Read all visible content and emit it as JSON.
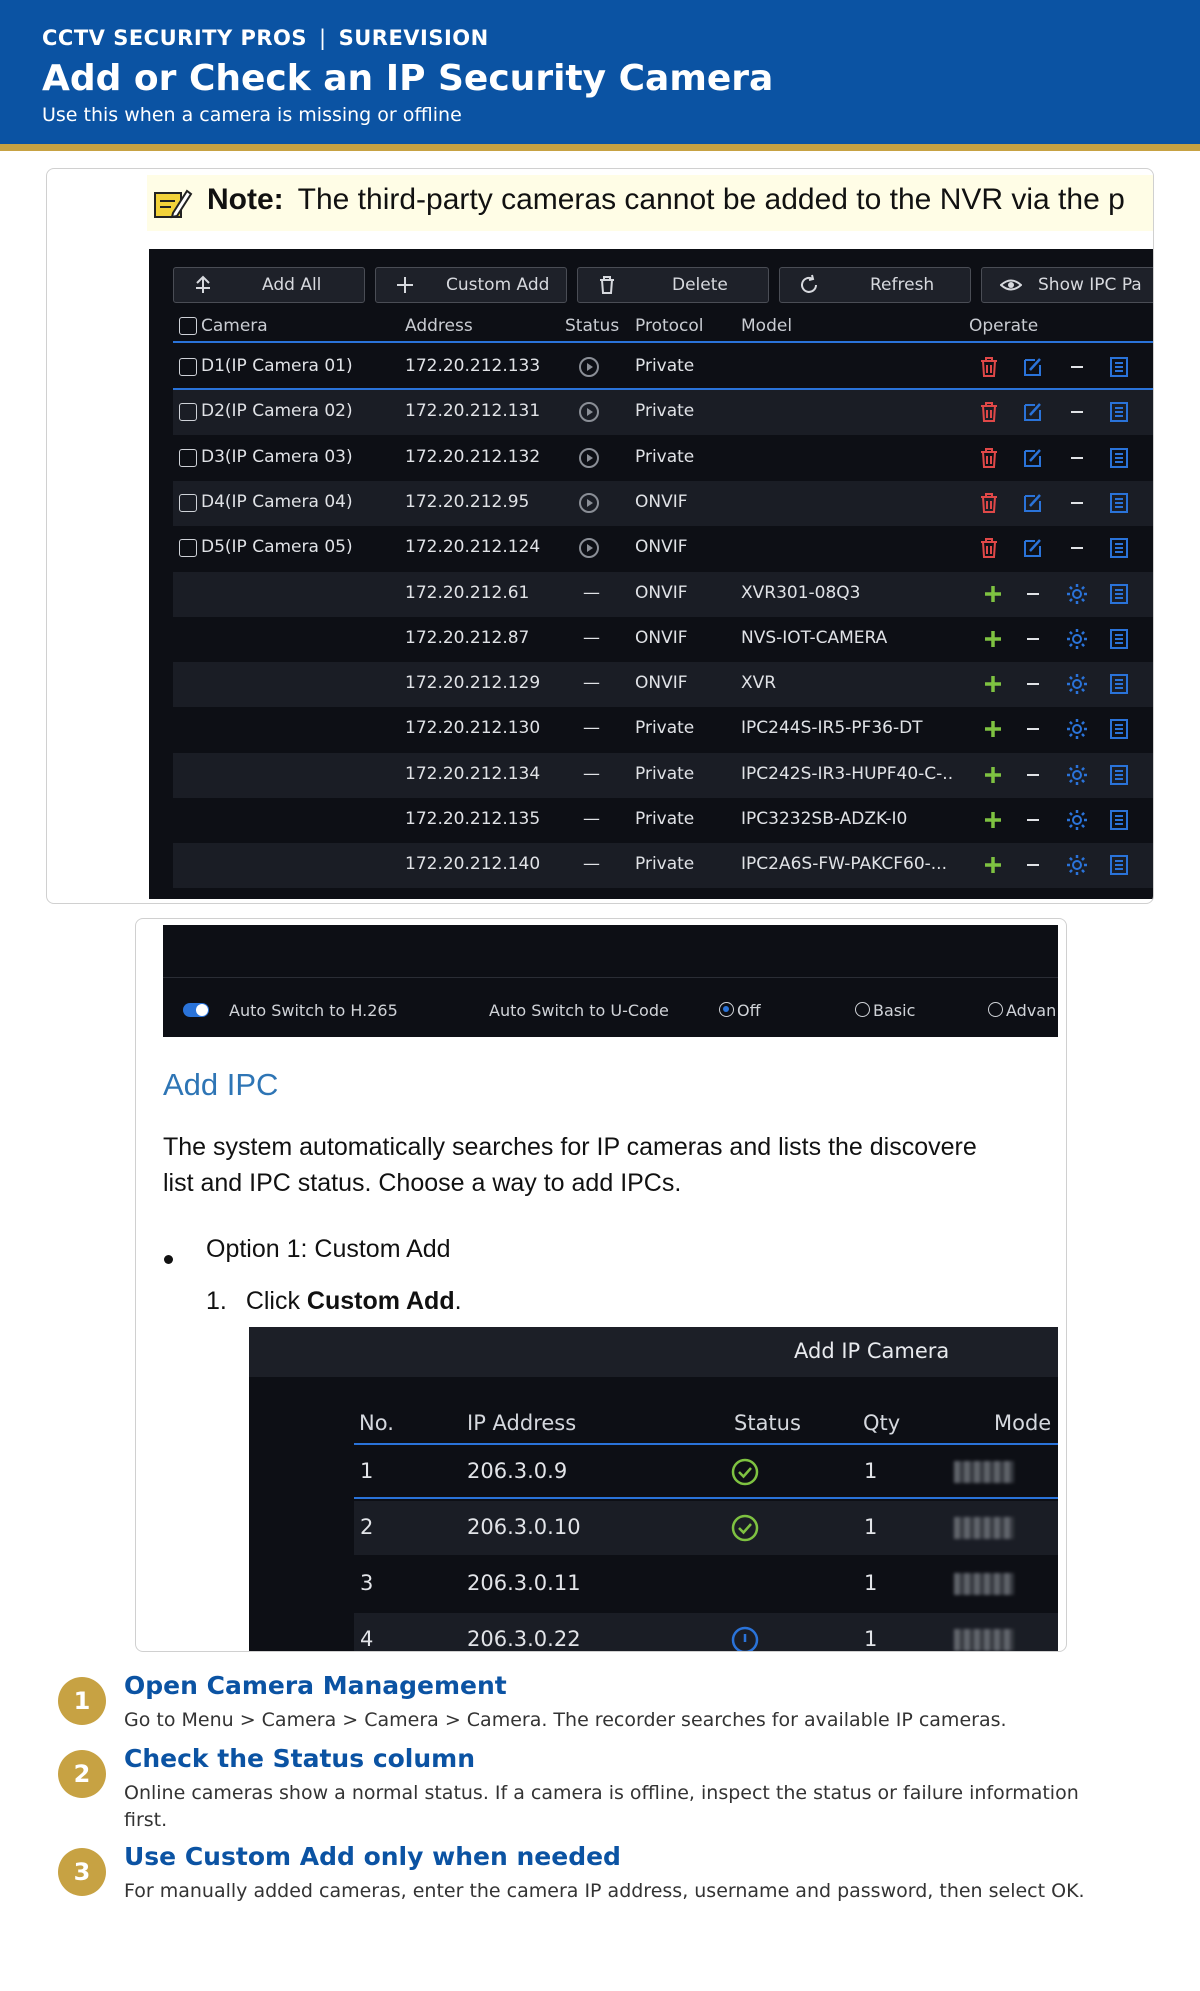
{
  "header": {
    "brand": "CCTV SECURITY PROS",
    "separator": "|",
    "product": "SUREVISION",
    "title": "Add or Check an IP Security Camera",
    "subtitle": "Use this when a camera is missing or offline"
  },
  "note": {
    "label": "Note:",
    "text": "The third-party cameras cannot be added to the NVR via the p"
  },
  "nvr": {
    "toolbar": [
      "Add All",
      "Custom Add",
      "Delete",
      "Refresh",
      "Show IPC Pa"
    ],
    "columns": [
      "Camera",
      "Address",
      "Status",
      "Protocol",
      "Model",
      "Operate"
    ],
    "rows": [
      {
        "camera": "D1(IP Camera 01)",
        "address": "172.20.212.133",
        "status": "play",
        "protocol": "Private",
        "model": "",
        "kind": "added"
      },
      {
        "camera": "D2(IP Camera 02)",
        "address": "172.20.212.131",
        "status": "play",
        "protocol": "Private",
        "model": "",
        "kind": "added"
      },
      {
        "camera": "D3(IP Camera 03)",
        "address": "172.20.212.132",
        "status": "play",
        "protocol": "Private",
        "model": "",
        "kind": "added"
      },
      {
        "camera": "D4(IP Camera 04)",
        "address": "172.20.212.95",
        "status": "play",
        "protocol": "ONVIF",
        "model": "",
        "kind": "added"
      },
      {
        "camera": "D5(IP Camera 05)",
        "address": "172.20.212.124",
        "status": "play",
        "protocol": "ONVIF",
        "model": "",
        "kind": "added"
      },
      {
        "camera": "",
        "address": "172.20.212.61",
        "status": "—",
        "protocol": "ONVIF",
        "model": "XVR301-08Q3",
        "kind": "found"
      },
      {
        "camera": "",
        "address": "172.20.212.87",
        "status": "—",
        "protocol": "ONVIF",
        "model": "NVS-IOT-CAMERA",
        "kind": "found"
      },
      {
        "camera": "",
        "address": "172.20.212.129",
        "status": "—",
        "protocol": "ONVIF",
        "model": "XVR",
        "kind": "found"
      },
      {
        "camera": "",
        "address": "172.20.212.130",
        "status": "—",
        "protocol": "Private",
        "model": "IPC244S-IR5-PF36-DT",
        "kind": "found"
      },
      {
        "camera": "",
        "address": "172.20.212.134",
        "status": "—",
        "protocol": "Private",
        "model": "IPC242S-IR3-HUPF40-C-..",
        "kind": "found"
      },
      {
        "camera": "",
        "address": "172.20.212.135",
        "status": "—",
        "protocol": "Private",
        "model": "IPC3232SB-ADZK-I0",
        "kind": "found"
      },
      {
        "camera": "",
        "address": "172.20.212.140",
        "status": "—",
        "protocol": "Private",
        "model": "IPC2A6S-FW-PAKCF60-...",
        "kind": "found"
      }
    ]
  },
  "codec": {
    "h265": "Auto Switch to H.265",
    "ucode": "Auto Switch to U-Code",
    "options": [
      "Off",
      "Basic",
      "Advan"
    ]
  },
  "doc": {
    "heading": "Add IPC",
    "para_line1": "The system automatically searches for IP cameras and lists the discovere",
    "para_line2": "list and IPC status. Choose a way to add IPCs.",
    "bullet": "Option 1: Custom Add",
    "step_prefix": "1.",
    "step_text": "Click ",
    "step_bold": "Custom Add",
    "step_end": "."
  },
  "add_ip_camera": {
    "title": "Add IP Camera",
    "columns": [
      "No.",
      "IP Address",
      "Status",
      "Qty",
      "Mode"
    ],
    "rows": [
      {
        "no": "1",
        "ip": "206.3.0.9",
        "qty": "1",
        "status": "ok"
      },
      {
        "no": "2",
        "ip": "206.3.0.10",
        "qty": "1",
        "status": "ok"
      },
      {
        "no": "3",
        "ip": "206.3.0.11",
        "qty": "1",
        "status": ""
      },
      {
        "no": "4",
        "ip": "206.3.0.22",
        "qty": "1",
        "status": "info"
      }
    ]
  },
  "steps": [
    {
      "num": "1",
      "title": "Open Camera Management",
      "desc": "Go to Menu > Camera > Camera > Camera. The recorder searches for available IP cameras."
    },
    {
      "num": "2",
      "title": "Check the Status column",
      "desc": "Online cameras show a normal status. If a camera is offline, inspect the status or failure information first."
    },
    {
      "num": "3",
      "title": "Use Custom Add only when needed",
      "desc": "For manually added cameras, enter the camera IP address, username and password, then select OK."
    }
  ],
  "colors": {
    "header_blue": "#0b53a3",
    "gold": "#c7a243",
    "nvr_dark": "#0d0f15",
    "accent_blue": "#2a73d9",
    "delete_red": "#e04848",
    "add_green": "#7ec241"
  }
}
